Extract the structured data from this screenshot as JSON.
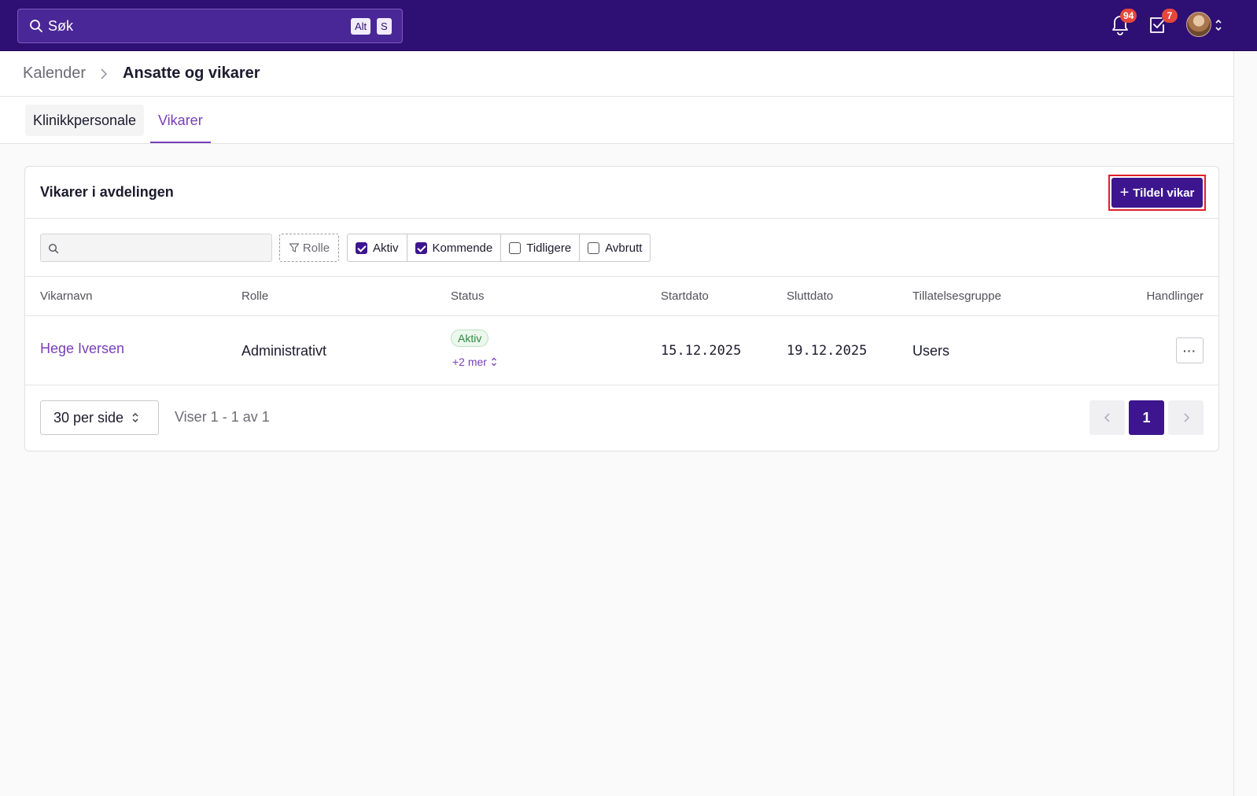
{
  "topbar": {
    "search_label": "Søk",
    "shortcut_keys": [
      "Alt",
      "S"
    ],
    "notifications_count": "94",
    "tasks_count": "7",
    "icons": [
      "search-icon",
      "bell-icon",
      "checkbox-icon",
      "avatar",
      "chevron-updown-icon"
    ]
  },
  "breadcrumb": {
    "parent": "Kalender",
    "current": "Ansatte og vikarer"
  },
  "tabs": [
    {
      "label": "Klinikkpersonale",
      "active": false
    },
    {
      "label": "Vikarer",
      "active": true
    }
  ],
  "card": {
    "title": "Vikarer i avdelingen",
    "primary_button": "Tildel vikar",
    "filters": {
      "search_placeholder": "",
      "role_button": "Rolle",
      "status_options": [
        {
          "label": "Aktiv",
          "checked": true
        },
        {
          "label": "Kommende",
          "checked": true
        },
        {
          "label": "Tidligere",
          "checked": false
        },
        {
          "label": "Avbrutt",
          "checked": false
        }
      ]
    },
    "table": {
      "columns": [
        "Vikarnavn",
        "Rolle",
        "Status",
        "Startdato",
        "Sluttdato",
        "Tillatelsesgruppe",
        "Handlinger"
      ],
      "rows": [
        {
          "name": "Hege Iversen",
          "role": "Administrativt",
          "status": "Aktiv",
          "status_more": "+2 mer",
          "start": "15.12.2025",
          "end": "19.12.2025",
          "group": "Users",
          "actions": "···"
        }
      ]
    },
    "pagination": {
      "per_page": "30 per side",
      "showing": "Viser 1 - 1 av 1",
      "current_page": "1"
    }
  },
  "colors": {
    "brand": "#2e0f73",
    "primary": "#3d168f",
    "link": "#7a3fb8",
    "success": "#2f8a3f",
    "badge": "#e5483b",
    "highlight": "#e0202a"
  }
}
